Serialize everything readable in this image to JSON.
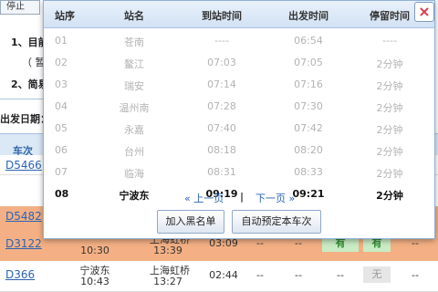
{
  "background": {
    "top_tab": "停止",
    "notes": [
      {
        "label": "1、目前"
      },
      {
        "label": "（ 暂"
      },
      {
        "label": "2、简易"
      }
    ],
    "date_label": "出发日期：",
    "header_col": "车次",
    "rows": [
      {
        "train": "D5466",
        "style": "white"
      },
      {
        "train": "D5482",
        "style": "orange"
      },
      {
        "train": "D3122",
        "style": "orange",
        "depart_time": "10:30",
        "arrive_station": "上海虹桥",
        "arrive_time": "13:39",
        "duration": "03:09",
        "c1": "--",
        "c2": "--",
        "c3": "有",
        "c4": "有",
        "c5": "--"
      },
      {
        "train": "D366",
        "style": "white",
        "depart_station": "宁波东",
        "depart_time": "10:43",
        "arrive_station": "上海虹桥",
        "arrive_time": "13:27",
        "duration": "02:44",
        "c1": "--",
        "c2": "--",
        "c3": "--",
        "c4": "无",
        "c5": "--"
      }
    ]
  },
  "popup": {
    "columns": {
      "no": "站序",
      "name": "站名",
      "arrive": "到站时间",
      "depart": "出发时间",
      "stay": "停留时间"
    },
    "stops": [
      {
        "no": "01",
        "name": "苍南",
        "arrive": "----",
        "depart": "06:54",
        "stay": "----"
      },
      {
        "no": "02",
        "name": "鳌江",
        "arrive": "07:03",
        "depart": "07:05",
        "stay": "2分钟"
      },
      {
        "no": "03",
        "name": "瑞安",
        "arrive": "07:14",
        "depart": "07:16",
        "stay": "2分钟"
      },
      {
        "no": "04",
        "name": "温州南",
        "arrive": "07:28",
        "depart": "07:30",
        "stay": "2分钟"
      },
      {
        "no": "05",
        "name": "永嘉",
        "arrive": "07:40",
        "depart": "07:42",
        "stay": "2分钟"
      },
      {
        "no": "06",
        "name": "台州",
        "arrive": "08:18",
        "depart": "08:20",
        "stay": "2分钟"
      },
      {
        "no": "07",
        "name": "临海",
        "arrive": "08:31",
        "depart": "08:33",
        "stay": "2分钟"
      },
      {
        "no": "08",
        "name": "宁波东",
        "arrive": "09:19",
        "depart": "09:21",
        "stay": "2分钟"
      }
    ],
    "pager": {
      "prev": "« 上一页",
      "separator": "|",
      "next": "下一页 »"
    },
    "buttons": {
      "blacklist": "加入黑名单",
      "auto_book": "自动预定本车次"
    },
    "close_glyph": "×",
    "colors": {
      "accent": "#2b63b3",
      "row_orange": "#f4b084",
      "available_green": "#c9ecc5"
    }
  }
}
